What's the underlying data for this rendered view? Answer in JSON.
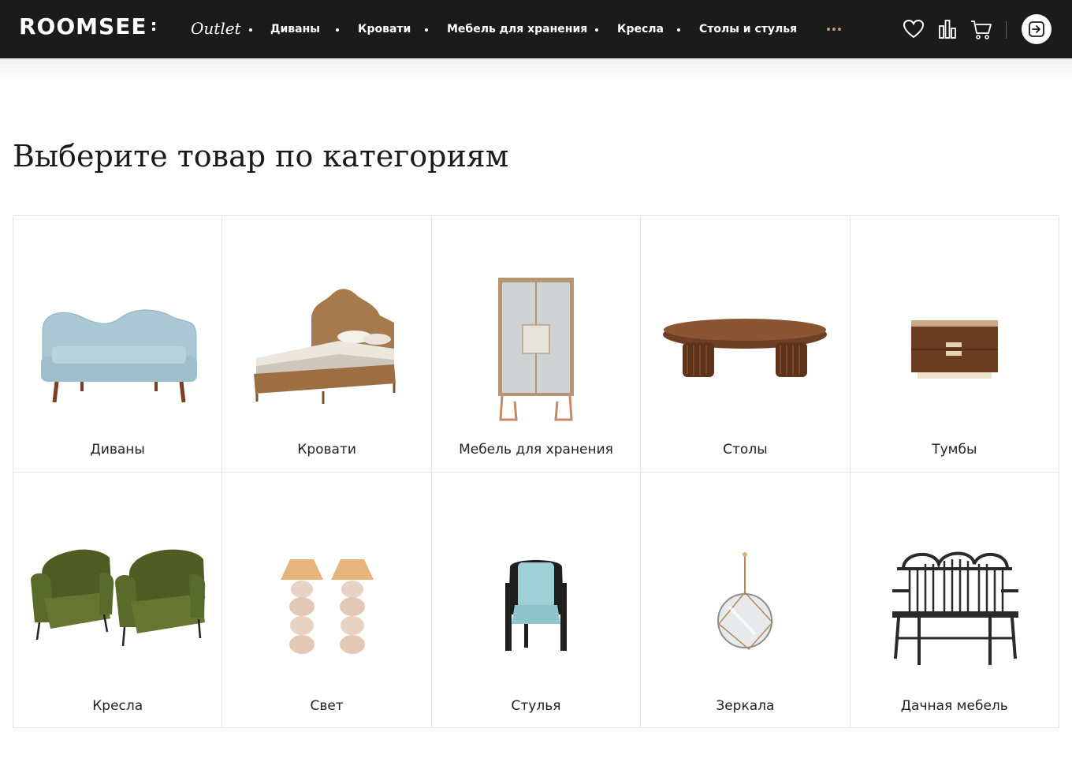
{
  "header": {
    "logo": "ROOMSEE",
    "outlet": "Outlet",
    "nav": [
      "Диваны",
      "Кровати",
      "Мебель для хранения",
      "Кресла",
      "Столы и стулья"
    ],
    "icons": [
      "heart-icon",
      "compare-icon",
      "cart-icon",
      "login-icon"
    ]
  },
  "page": {
    "title": "Выберите товар по категориям"
  },
  "categories": [
    {
      "label": "Диваны",
      "icon": "sofa"
    },
    {
      "label": "Кровати",
      "icon": "bed"
    },
    {
      "label": "Мебель для хранения",
      "icon": "cabinet"
    },
    {
      "label": "Столы",
      "icon": "table"
    },
    {
      "label": "Тумбы",
      "icon": "nightstand"
    },
    {
      "label": "Кресла",
      "icon": "armchairs"
    },
    {
      "label": "Свет",
      "icon": "lamps"
    },
    {
      "label": "Стулья",
      "icon": "chair"
    },
    {
      "label": "Зеркала",
      "icon": "mirror"
    },
    {
      "label": "Дачная мебель",
      "icon": "bench"
    }
  ],
  "colors": {
    "header_bg": "#1b1b1b",
    "accent": "#c89a6a",
    "border": "#e6e6e6"
  }
}
